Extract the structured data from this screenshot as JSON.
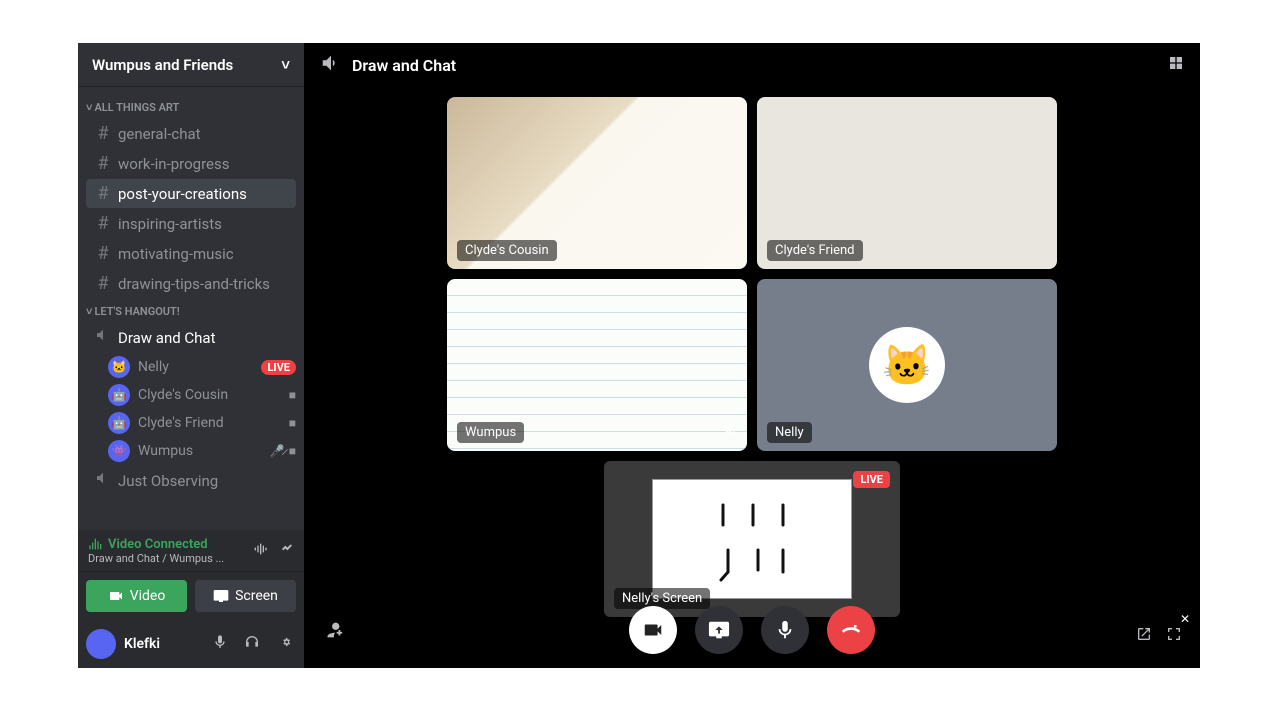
{
  "server": {
    "name": "Wumpus and Friends"
  },
  "categories": [
    {
      "name": "ALL THINGS ART",
      "channels": [
        {
          "id": "general-chat",
          "label": "general-chat",
          "type": "text"
        },
        {
          "id": "work-in-progress",
          "label": "work-in-progress",
          "type": "text"
        },
        {
          "id": "post-your-creations",
          "label": "post-your-creations",
          "type": "text",
          "active": true
        },
        {
          "id": "inspiring-artists",
          "label": "inspiring-artists",
          "type": "text"
        },
        {
          "id": "motivating-music",
          "label": "motivating-music",
          "type": "text"
        },
        {
          "id": "drawing-tips",
          "label": "drawing-tips-and-tricks",
          "type": "text"
        }
      ]
    },
    {
      "name": "LET'S HANGOUT!",
      "channels": [
        {
          "id": "draw-and-chat",
          "label": "Draw and Chat",
          "type": "voice",
          "voiceActive": true,
          "members": [
            {
              "name": "Nelly",
              "live": true
            },
            {
              "name": "Clyde's Cousin",
              "cam": true
            },
            {
              "name": "Clyde's Friend",
              "cam": true
            },
            {
              "name": "Wumpus",
              "muted": true,
              "cam": true
            }
          ]
        },
        {
          "id": "just-observing",
          "label": "Just Observing",
          "type": "voice"
        }
      ]
    }
  ],
  "voiceStatus": {
    "title": "Video Connected",
    "sub": "Draw and Chat / Wumpus ...",
    "videoBtn": "Video",
    "screenBtn": "Screen"
  },
  "user": {
    "name": "Klefki"
  },
  "callHeader": {
    "channel": "Draw and Chat"
  },
  "tiles": [
    {
      "label": "Clyde's Cousin"
    },
    {
      "label": "Clyde's Friend"
    },
    {
      "label": "Wumpus",
      "muted": true
    },
    {
      "label": "Nelly",
      "avatarOnly": true
    }
  ],
  "screenShare": {
    "label": "Nelly's Screen",
    "live": "LIVE"
  },
  "badges": {
    "live": "LIVE"
  }
}
